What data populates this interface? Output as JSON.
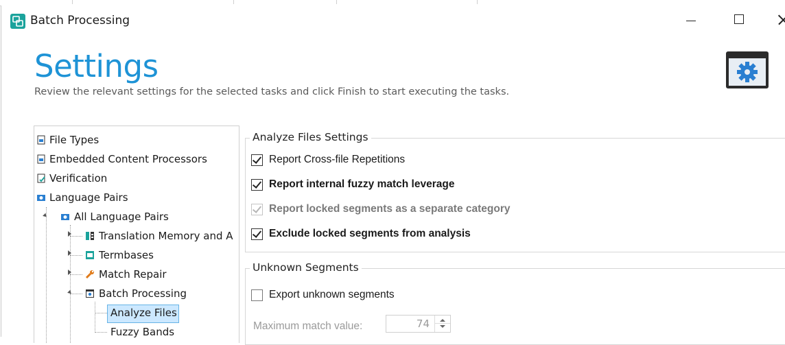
{
  "window": {
    "title": "Batch Processing"
  },
  "header": {
    "heading": "Settings",
    "subtitle": "Review the relevant settings for the selected tasks and click Finish to start executing the tasks."
  },
  "tree": {
    "items": [
      {
        "label": "File Types"
      },
      {
        "label": "Embedded Content Processors"
      },
      {
        "label": "Verification"
      },
      {
        "label": "Language Pairs"
      },
      {
        "label": "All Language Pairs"
      },
      {
        "label": "Translation Memory and A"
      },
      {
        "label": "Termbases"
      },
      {
        "label": "Match Repair"
      },
      {
        "label": "Batch Processing"
      },
      {
        "label": "Analyze Files",
        "selected": true
      },
      {
        "label": "Fuzzy Bands"
      }
    ]
  },
  "analyze_settings": {
    "group_title": "Analyze Files Settings",
    "options": [
      {
        "label": "Report Cross-file Repetitions",
        "checked": true,
        "enabled": true
      },
      {
        "label": "Report internal fuzzy match leverage",
        "checked": true,
        "enabled": true
      },
      {
        "label": "Report locked segments as a separate category",
        "checked": true,
        "enabled": false
      },
      {
        "label": "Exclude locked segments from analysis",
        "checked": true,
        "enabled": true
      }
    ]
  },
  "unknown_segments": {
    "group_title": "Unknown Segments",
    "export_label": "Export unknown segments",
    "export_checked": false,
    "max_match_label": "Maximum match value:",
    "max_match_value": "74"
  },
  "colors": {
    "accent": "#1e93d6",
    "selection": "#cce8ff",
    "app_icon": "#1ba39c"
  },
  "icons": {
    "app": "batch-processing-icon",
    "settings": "settings-gear-window-icon"
  }
}
